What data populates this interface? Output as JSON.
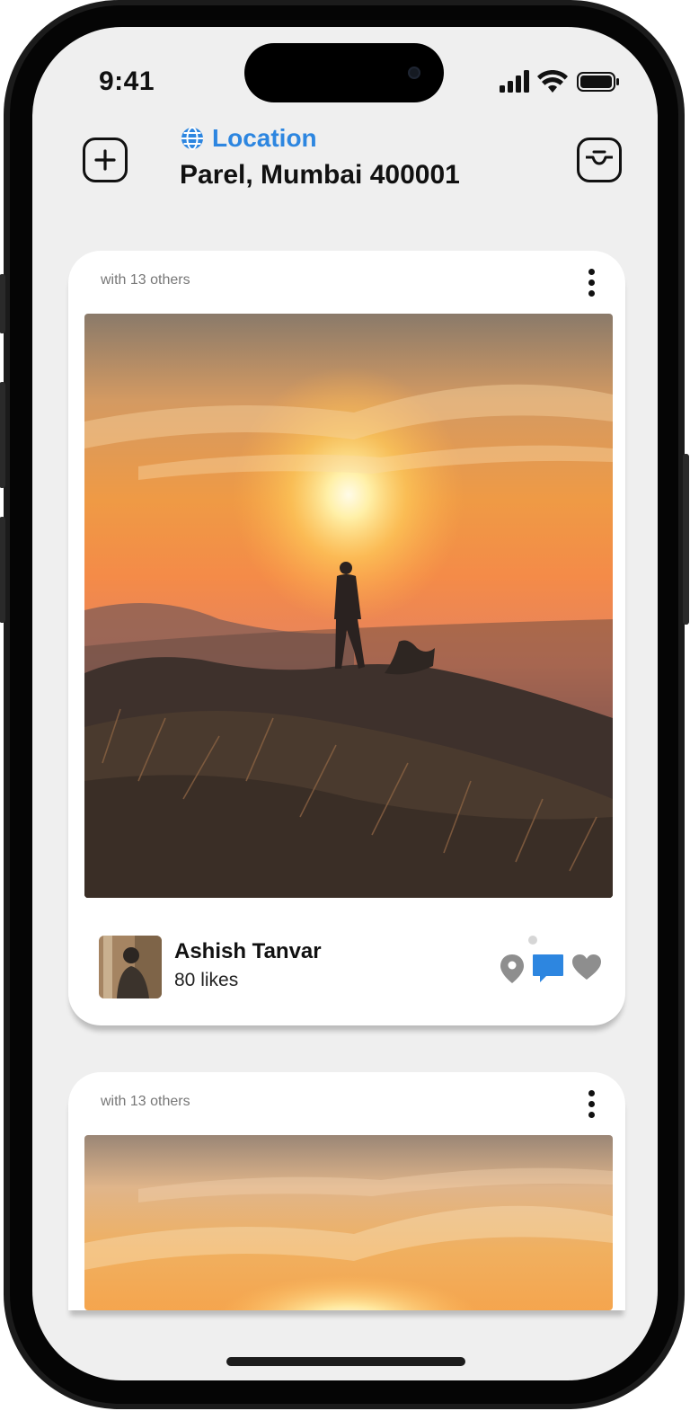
{
  "status_bar": {
    "time": "9:41"
  },
  "header": {
    "location_label": "Location",
    "address": "Parel, Mumbai 400001",
    "add_icon": "plus-square-icon",
    "inbox_icon": "inbox-tray-icon",
    "globe_icon": "globe-icon",
    "accent_color": "#2d86e0"
  },
  "posts": [
    {
      "with_text": "with 13 others",
      "author": "Ashish Tanvar",
      "likes": "80 likes",
      "actions": [
        "location-pin-icon",
        "comment-icon",
        "heart-icon"
      ]
    },
    {
      "with_text": "with 13 others"
    }
  ]
}
